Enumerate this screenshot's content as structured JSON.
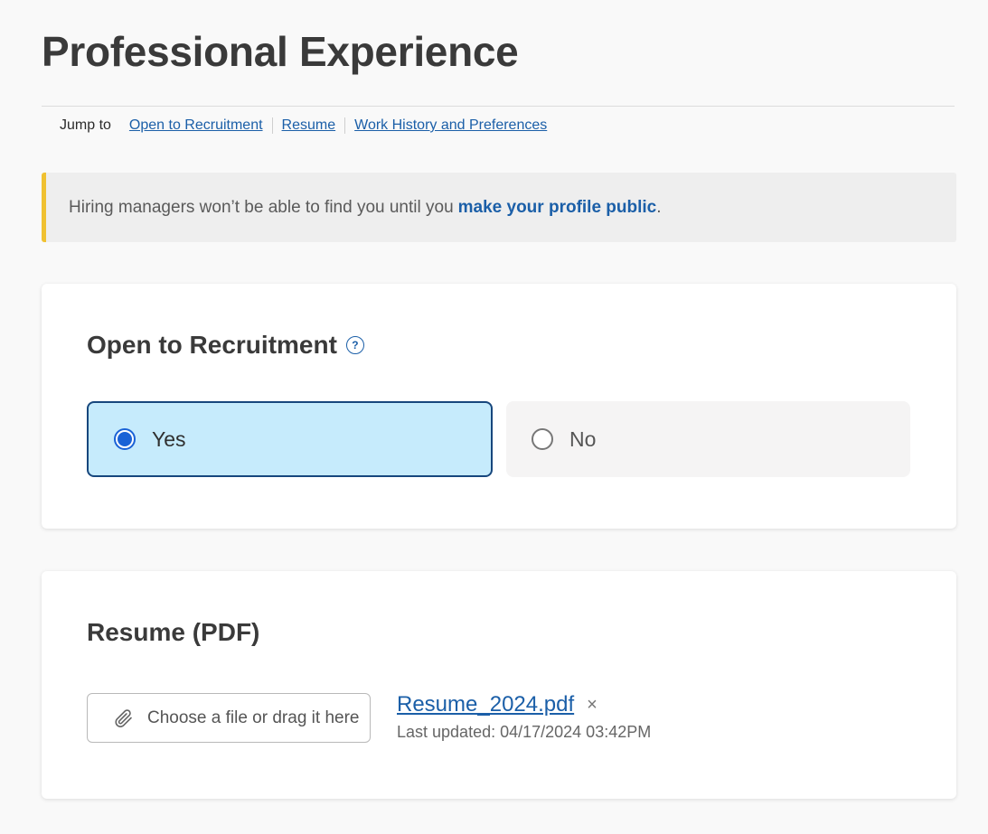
{
  "page": {
    "title": "Professional Experience"
  },
  "jump_nav": {
    "label": "Jump to",
    "links": [
      {
        "label": "Open to Recruitment"
      },
      {
        "label": "Resume"
      },
      {
        "label": "Work History and Preferences"
      }
    ]
  },
  "alert": {
    "text": "Hiring managers won’t be able to find you until you",
    "link_label": "make your profile public",
    "suffix": ".",
    "accent_color": "#f0c131"
  },
  "recruitment": {
    "heading": "Open to Recruitment",
    "help_icon": "question-circle-icon",
    "help_glyph": "?",
    "options": [
      {
        "label": "Yes",
        "selected": true
      },
      {
        "label": "No",
        "selected": false
      }
    ]
  },
  "resume": {
    "heading": "Resume (PDF)",
    "upload_label": "Choose a file or drag it here",
    "upload_icon": "paperclip-icon",
    "file_name": "Resume_2024.pdf",
    "remove_glyph": "×",
    "last_updated": "Last updated: 04/17/2024 03:42PM"
  },
  "colors": {
    "link": "#1b5fa8",
    "selected_bg": "#c6ebfc",
    "selected_border": "#17477d",
    "radio_accent": "#1a62d6"
  }
}
